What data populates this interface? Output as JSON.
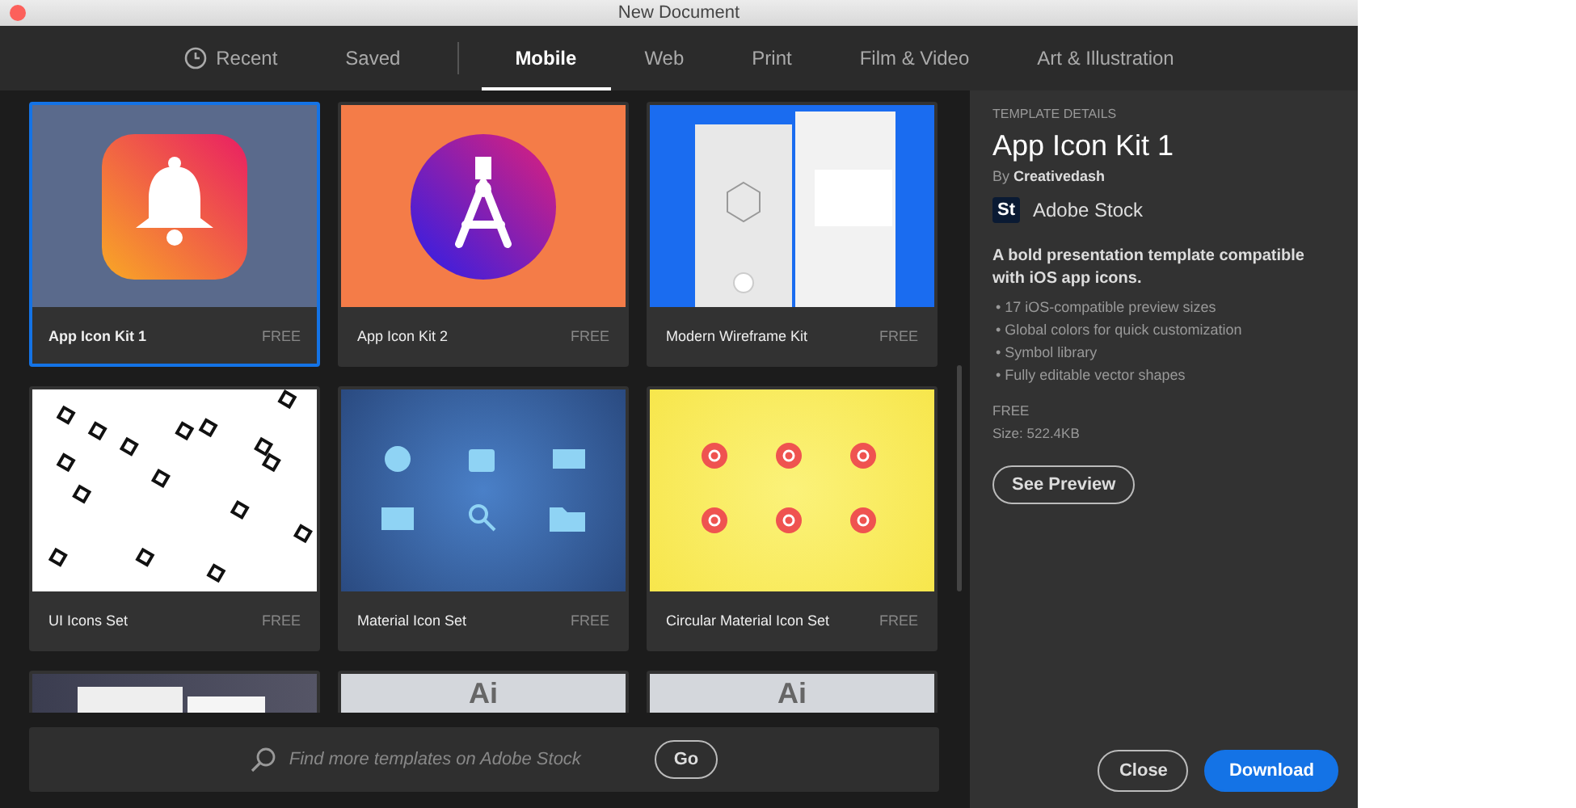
{
  "window": {
    "title": "New Document"
  },
  "tabs": [
    {
      "label": "Recent",
      "selected": false
    },
    {
      "label": "Saved",
      "selected": false
    },
    {
      "label": "Mobile",
      "selected": true
    },
    {
      "label": "Web",
      "selected": false
    },
    {
      "label": "Print",
      "selected": false
    },
    {
      "label": "Film & Video",
      "selected": false
    },
    {
      "label": "Art & Illustration",
      "selected": false
    }
  ],
  "templates": [
    {
      "kind": "bell",
      "title": "App Icon Kit 1",
      "price": "FREE",
      "selected": true
    },
    {
      "kind": "compass",
      "title": "App Icon Kit 2",
      "price": "FREE",
      "selected": false
    },
    {
      "kind": "wireframe",
      "title": "Modern Wireframe Kit",
      "price": "FREE",
      "selected": false
    },
    {
      "kind": "pattern",
      "title": "UI Icons Set",
      "price": "FREE",
      "selected": false
    },
    {
      "kind": "material",
      "title": "Material Icon Set",
      "price": "FREE",
      "selected": false
    },
    {
      "kind": "circular",
      "title": "Circular Material Icon Set",
      "price": "FREE",
      "selected": false
    },
    {
      "kind": "screens",
      "selected": false
    },
    {
      "kind": "ai",
      "thumb_text": "Ai",
      "selected": false
    },
    {
      "kind": "ai",
      "thumb_text": "Ai",
      "selected": false
    }
  ],
  "search": {
    "placeholder": "Find more templates on Adobe Stock",
    "button": "Go"
  },
  "details": {
    "heading": "TEMPLATE DETAILS",
    "title": "App Icon Kit 1",
    "author_prefix": "By",
    "author": "Creativedash",
    "source_badge": "St",
    "source": "Adobe Stock",
    "description": "A bold presentation template compatible with iOS app icons.",
    "features": [
      "• 17 iOS-compatible preview sizes",
      "• Global colors for quick customization",
      "• Symbol library",
      "• Fully editable vector shapes"
    ],
    "price": "FREE",
    "size": "Size: 522.4KB",
    "preview_button": "See Preview"
  },
  "footer": {
    "buttons": [
      {
        "label": "Close",
        "kind": "secondary"
      },
      {
        "label": "Download",
        "kind": "primary"
      }
    ]
  }
}
